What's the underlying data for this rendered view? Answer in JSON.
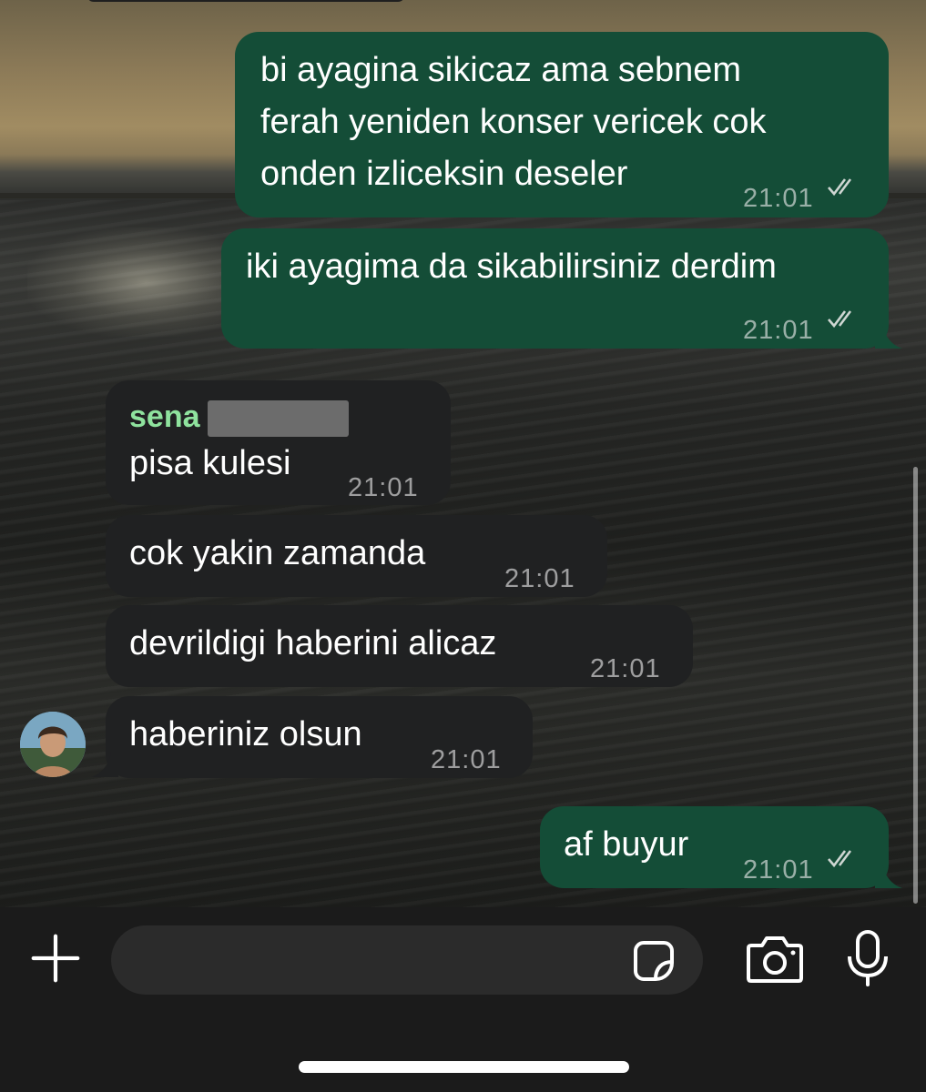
{
  "messages": [
    {
      "direction": "outgoing",
      "lines": [
        "bi ayagina sikicaz ama sebnem",
        "ferah yeniden konser vericek cok",
        "onden izliceksin deseler"
      ],
      "time": "21:01",
      "status": "read"
    },
    {
      "direction": "outgoing",
      "lines": [
        "iki ayagima da sikabilirsiniz derdim"
      ],
      "time": "21:01",
      "status": "read"
    },
    {
      "direction": "incoming",
      "sender": "sena",
      "lines": [
        "pisa kulesi"
      ],
      "time": "21:01"
    },
    {
      "direction": "incoming",
      "lines": [
        "cok yakin zamanda"
      ],
      "time": "21:01"
    },
    {
      "direction": "incoming",
      "lines": [
        "devrildigi haberini alicaz"
      ],
      "time": "21:01"
    },
    {
      "direction": "incoming",
      "lines": [
        "haberiniz olsun"
      ],
      "time": "21:01"
    },
    {
      "direction": "outgoing",
      "lines": [
        "af buyur"
      ],
      "time": "21:01",
      "status": "read"
    }
  ],
  "composer": {
    "input_value": "",
    "icons": [
      "plus-icon",
      "sticker-icon",
      "camera-icon",
      "microphone-icon"
    ]
  },
  "colors": {
    "outgoing_bubble": "#144d37",
    "incoming_bubble": "#202122",
    "sender_name": "#8fe39e",
    "read_ticks": "#cfd6d2"
  }
}
